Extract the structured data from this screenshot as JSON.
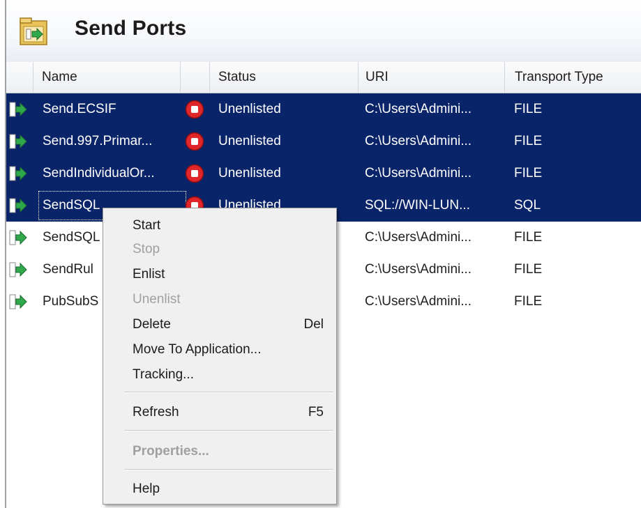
{
  "window": {
    "title": "Send Ports",
    "title_icon": "send-ports-folder-icon"
  },
  "columns": [
    {
      "label": "Name"
    },
    {
      "label": "Status"
    },
    {
      "label": "URI"
    },
    {
      "label": "Transport Type"
    }
  ],
  "rows": [
    {
      "name": "Send.ECSIF",
      "status": "Unenlisted",
      "uri": "C:\\Users\\Admini...",
      "transport": "FILE",
      "selected": true
    },
    {
      "name": "Send.997.Primar...",
      "status": "Unenlisted",
      "uri": "C:\\Users\\Admini...",
      "transport": "FILE",
      "selected": true
    },
    {
      "name": "SendIndividualOr...",
      "status": "Unenlisted",
      "uri": "C:\\Users\\Admini...",
      "transport": "FILE",
      "selected": true
    },
    {
      "name": "SendSQL",
      "status": "Unenlisted",
      "uri": "SQL://WIN-LUN...",
      "transport": "SQL",
      "selected": true,
      "focused": true
    },
    {
      "name": "SendSQL",
      "status": "",
      "uri": "C:\\Users\\Admini...",
      "transport": "FILE",
      "selected": false
    },
    {
      "name": "SendRul",
      "status": "",
      "uri": "C:\\Users\\Admini...",
      "transport": "FILE",
      "selected": false
    },
    {
      "name": "PubSubS",
      "status": "",
      "uri": "C:\\Users\\Admini...",
      "transport": "FILE",
      "selected": false
    }
  ],
  "context_menu": {
    "start": "Start",
    "stop": "Stop",
    "enlist": "Enlist",
    "unenlist": "Unenlist",
    "delete": "Delete",
    "delete_key": "Del",
    "move": "Move To Application...",
    "tracking": "Tracking...",
    "refresh": "Refresh",
    "refresh_key": "F5",
    "properties": "Properties...",
    "help": "Help"
  },
  "colors": {
    "selection": "#0a246a",
    "status_stopped": "#e0252b",
    "port_icon_green": "#2fa94a"
  }
}
